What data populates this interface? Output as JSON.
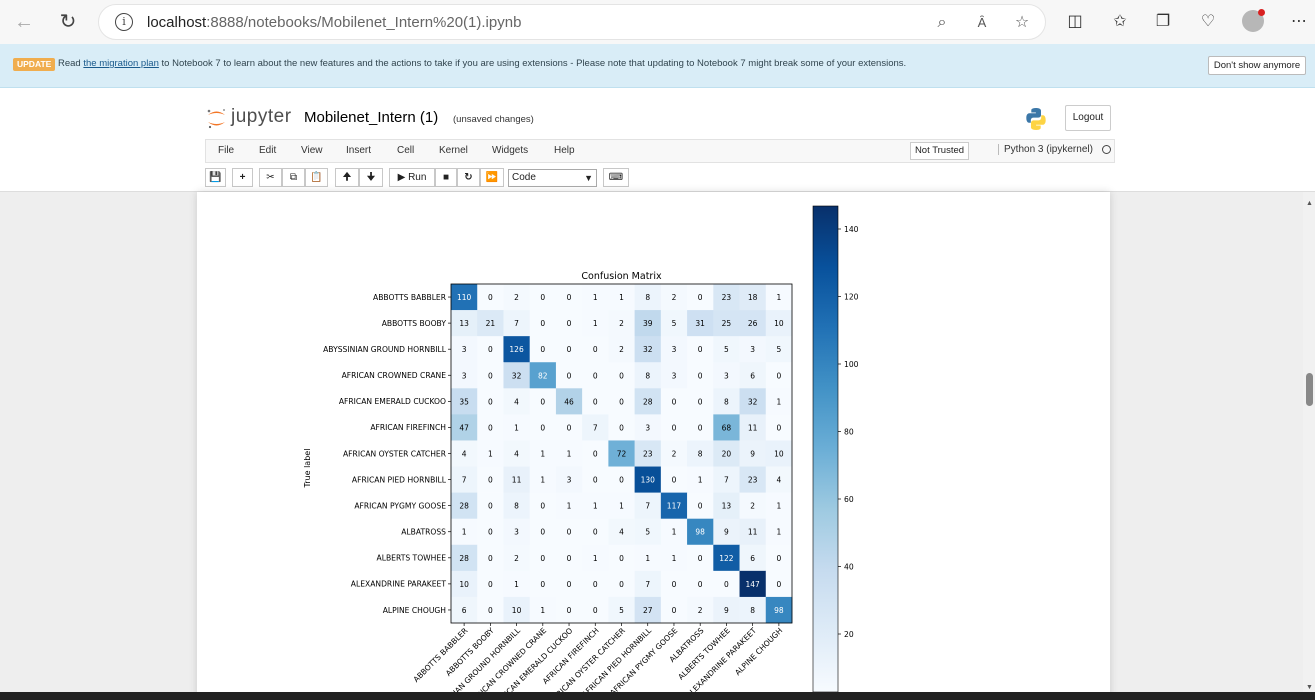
{
  "browser": {
    "url_host": "localhost",
    "url_path": ":8888/notebooks/Mobilenet_Intern%20(1).ipynb",
    "read_aloud_label": "Ȃ"
  },
  "banner": {
    "badge": "UPDATE",
    "text_before": "Read ",
    "link": "the migration plan",
    "text_after": " to Notebook 7 to learn about the new features and the actions to take if you are using extensions - Please note that updating to Notebook 7 might break some of your extensions.",
    "dismiss_label": "Don't show anymore"
  },
  "header": {
    "logo_text": "jupyter",
    "notebook_name": "Mobilenet_Intern (1)",
    "save_status": "(unsaved changes)",
    "logout_label": "Logout"
  },
  "menu": {
    "items": [
      "File",
      "Edit",
      "View",
      "Insert",
      "Cell",
      "Kernel",
      "Widgets",
      "Help"
    ],
    "trust_label": "Not Trusted",
    "kernel_label": "Python 3 (ipykernel)"
  },
  "toolbar": {
    "run_label": "Run",
    "cell_type": "Code"
  },
  "chart_data": {
    "type": "heatmap",
    "title": "Confusion Matrix",
    "ylabel": "True label",
    "colormap": "Blues",
    "colorbar_ticks": [
      20,
      40,
      60,
      80,
      100,
      120,
      140
    ],
    "row_labels": [
      "ABBOTTS BABBLER",
      "ABBOTTS BOOBY",
      "ABYSSINIAN GROUND HORNBILL",
      "AFRICAN CROWNED CRANE",
      "AFRICAN EMERALD CUCKOO",
      "AFRICAN FIREFINCH",
      "AFRICAN OYSTER CATCHER",
      "AFRICAN PIED HORNBILL",
      "AFRICAN PYGMY GOOSE",
      "ALBATROSS",
      "ALBERTS TOWHEE",
      "ALEXANDRINE PARAKEET",
      "ALPINE CHOUGH"
    ],
    "col_labels": [
      "ABBOTTS BABBLER",
      "ABBOTTS BOOBY",
      "ABYSSINIAN GROUND HORNBILL",
      "AFRICAN CROWNED CRANE",
      "AFRICAN EMERALD CUCKOO",
      "AFRICAN FIREFINCH",
      "AFRICAN OYSTER CATCHER",
      "AFRICAN PIED HORNBILL",
      "AFRICAN PYGMY GOOSE",
      "ALBATROSS",
      "ALBERTS TOWHEE",
      "ALEXANDRINE PARAKEET",
      "ALPINE CHOUGH"
    ],
    "values": [
      [
        110,
        0,
        2,
        0,
        0,
        1,
        1,
        8,
        2,
        0,
        23,
        18,
        1
      ],
      [
        13,
        21,
        7,
        0,
        0,
        1,
        2,
        39,
        5,
        31,
        25,
        26,
        10
      ],
      [
        3,
        0,
        126,
        0,
        0,
        0,
        2,
        32,
        3,
        0,
        5,
        3,
        5
      ],
      [
        3,
        0,
        32,
        82,
        0,
        0,
        0,
        8,
        3,
        0,
        3,
        6,
        0
      ],
      [
        35,
        0,
        4,
        0,
        46,
        0,
        0,
        28,
        0,
        0,
        8,
        32,
        1
      ],
      [
        47,
        0,
        1,
        0,
        0,
        7,
        0,
        3,
        0,
        0,
        68,
        11,
        0
      ],
      [
        4,
        1,
        4,
        1,
        1,
        0,
        72,
        23,
        2,
        8,
        20,
        9,
        10
      ],
      [
        7,
        0,
        11,
        1,
        3,
        0,
        0,
        130,
        0,
        1,
        7,
        23,
        4
      ],
      [
        28,
        0,
        8,
        0,
        1,
        1,
        1,
        7,
        117,
        0,
        13,
        2,
        1
      ],
      [
        1,
        0,
        3,
        0,
        0,
        0,
        4,
        5,
        1,
        98,
        9,
        11,
        1
      ],
      [
        28,
        0,
        2,
        0,
        0,
        1,
        0,
        1,
        1,
        0,
        122,
        6,
        0
      ],
      [
        10,
        0,
        1,
        0,
        0,
        0,
        0,
        7,
        0,
        0,
        0,
        147,
        0
      ],
      [
        6,
        0,
        10,
        1,
        0,
        0,
        5,
        27,
        0,
        2,
        9,
        8,
        98
      ]
    ],
    "vmin": 0,
    "vmax": 147
  },
  "colors": {
    "accent": "#f37626",
    "banner_bg": "#d9edf7",
    "cmap_low": "#f7fbff",
    "cmap_high": "#08306b"
  }
}
